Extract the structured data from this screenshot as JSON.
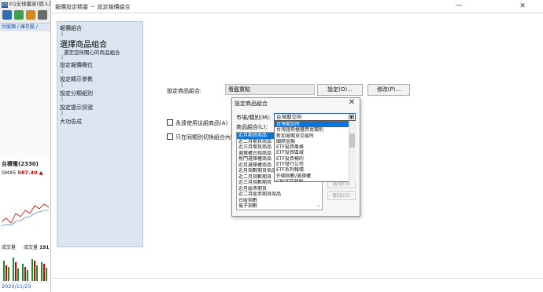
{
  "background_app": {
    "title": "XQ全球贏家(個人版)",
    "tabs": "台股類 / 庫存股 /",
    "quote_header": "台積電(2330)",
    "sma_label": "SMA5",
    "sma_value": "587.40",
    "volume_label": "成交量",
    "volume_label2": "成交量",
    "volume_value": "191",
    "date": "2020/11/23"
  },
  "main_window": {
    "title": "報價設定精靈 － 設定報價組合",
    "minimize": "—",
    "close": "✕"
  },
  "steps": [
    {
      "label": "報價組合",
      "style": "normal"
    },
    {
      "label": "選擇商品組合",
      "style": "big"
    },
    {
      "label": "選定您所關心的商品組合",
      "style": "sub"
    },
    {
      "label": "設定報價欄位",
      "style": "normal"
    },
    {
      "label": "設定顯示參數",
      "style": "normal"
    },
    {
      "label": "設定分類組別",
      "style": "normal"
    },
    {
      "label": "設定提示訊號",
      "style": "normal"
    },
    {
      "label": "大功告成",
      "style": "normal"
    }
  ],
  "form": {
    "set_combo_label": "設定商品組合:",
    "combo_value": "看盤重點",
    "set_button": "設定(O)...",
    "edit_button": "修改(P)...",
    "always_use_label": "永遠使用這組商品(A)",
    "switch_label": "只在同類別切換組合內容"
  },
  "dialog": {
    "title": "設定商品組合",
    "close": "✕",
    "market_label": "市場/類別(M):",
    "market_value": "台灣期交所",
    "combo_label": "商品組合(L):",
    "combo_items": [
      "近月期貨商品",
      "近二月期貨商品",
      "近三月期貨商品",
      "選擇權台指商品",
      "熱門選擇權商品",
      "近月選擇權商品",
      "近月指數期貨商品",
      "近二月指數期貨",
      "近三月指數期貨",
      "近月股票期貨",
      "近二月股票期貨商品",
      "台股指數",
      "電子指數",
      "金融指數"
    ],
    "combo_selected_index": 0,
    "market_options": [
      "台灣期交所",
      "台灣證券櫃檯買賣類別",
      "新加坡期貨交易所",
      "國際金融",
      "ETF投資風格",
      "ETF投資區域",
      "ETF投資標的",
      "ETF發行公司",
      "ETF系列報價",
      "外國指數/選擇權",
      "CBOT交易所"
    ],
    "market_selected_index": 0,
    "delete_button": "刪除(D)",
    "ghost_button": "新增(N)"
  },
  "colors": {
    "accent": "#0b74d9",
    "sidebar_bg": "#dce6f2",
    "price_up": "#cc0000"
  }
}
